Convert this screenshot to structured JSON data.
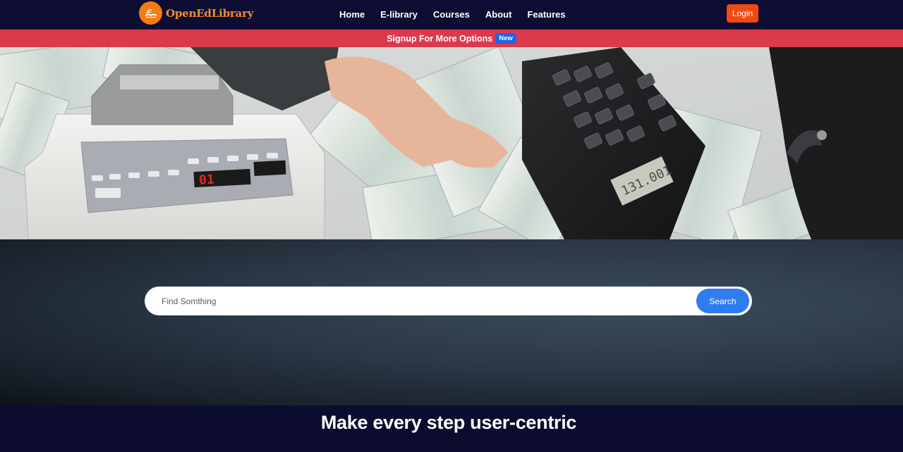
{
  "brand": {
    "name": "OpenEdLibrary",
    "logo_icon": "open-book-icon",
    "logo_color": "#f47c15"
  },
  "nav": {
    "items": [
      {
        "label": "Home"
      },
      {
        "label": "E-library"
      },
      {
        "label": "Courses"
      },
      {
        "label": "About"
      },
      {
        "label": "Features"
      }
    ],
    "login_label": "Login",
    "login_color": "#ee4a13"
  },
  "announcement": {
    "text": "Signup For More Options",
    "badge": "New",
    "bar_color": "#db3a4c",
    "badge_color": "#1e64f0"
  },
  "hero": {
    "counter_display": "01",
    "calculator_display": "131.001"
  },
  "search": {
    "placeholder": "Find Somthing",
    "value": "",
    "button_label": "Search",
    "button_color": "#2f7cf0"
  },
  "tagline": "Make every step user-centric"
}
